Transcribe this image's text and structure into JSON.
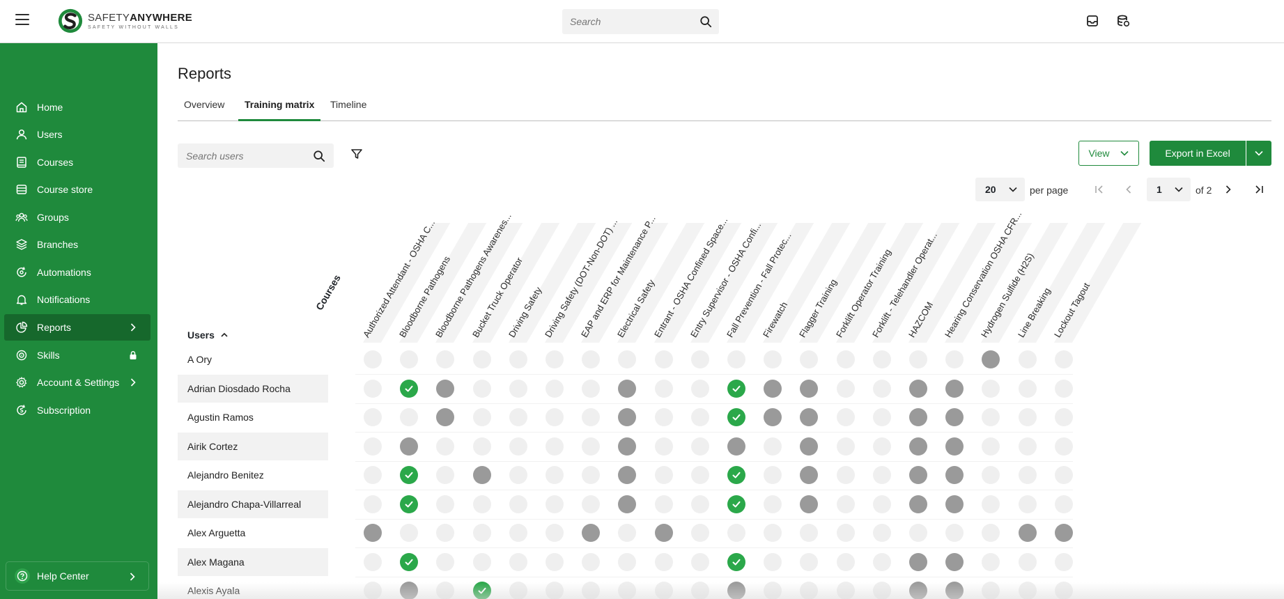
{
  "brand": {
    "name_light": "SAFETY",
    "name_bold": "ANYWHERE",
    "tagline": "SAFETY WITHOUT WALLS"
  },
  "topbar": {
    "search_placeholder": "Search"
  },
  "sidebar": {
    "items": [
      {
        "label": "Home",
        "icon": "home-icon"
      },
      {
        "label": "Users",
        "icon": "user-icon"
      },
      {
        "label": "Courses",
        "icon": "book-icon"
      },
      {
        "label": "Course store",
        "icon": "store-icon"
      },
      {
        "label": "Groups",
        "icon": "groups-icon"
      },
      {
        "label": "Branches",
        "icon": "layers-icon"
      },
      {
        "label": "Automations",
        "icon": "automation-icon"
      },
      {
        "label": "Notifications",
        "icon": "bell-icon"
      },
      {
        "label": "Reports",
        "icon": "pie-chart-icon"
      },
      {
        "label": "Skills",
        "icon": "skills-icon"
      },
      {
        "label": "Account & Settings",
        "icon": "gear-icon"
      },
      {
        "label": "Subscription",
        "icon": "subscription-icon"
      }
    ],
    "help_label": "Help Center"
  },
  "page": {
    "title": "Reports",
    "tabs": [
      "Overview",
      "Training matrix",
      "Timeline"
    ],
    "active_tab": "Training matrix"
  },
  "toolbar": {
    "search_placeholder": "Search users",
    "view_label": "View",
    "export_label": "Export in Excel"
  },
  "pagination": {
    "per_page_value": "20",
    "per_page_label": "per page",
    "page_value": "1",
    "of_label": "of 2"
  },
  "matrix": {
    "courses_label": "Courses",
    "users_label": "Users",
    "courses": [
      "Authorized Attendant - OSHA C...",
      "Bloodborne Pathogens",
      "Bloodborne Pathogens Awarenes...",
      "Bucket Truck Operator",
      "Driving Safety",
      "Driving Safety (DOT-Non-DOT) ...",
      "EAP and ERP for Maintenance P...",
      "Electrical Safety",
      "Entrant - OSHA Confined Space...",
      "Entry Supervisor - OSHA Confi...",
      "Fall Prevention - Fall Protec...",
      "Firewatch",
      "Flagger Training",
      "Forklift Operator Training",
      "Forklift - Telehandler Operat...",
      "HAZCOM",
      "Hearing Conservation OSHA CFR...",
      "Hydrogen Sulfide (H2S)",
      "Line Breaking",
      "Lockout Tagout"
    ],
    "rows": [
      {
        "name": "A Ory",
        "cells": [
          0,
          0,
          0,
          0,
          0,
          0,
          0,
          0,
          0,
          0,
          0,
          0,
          0,
          0,
          0,
          0,
          0,
          1,
          0,
          0
        ]
      },
      {
        "name": "Adrian Diosdado Rocha",
        "cells": [
          0,
          2,
          1,
          0,
          0,
          0,
          0,
          1,
          0,
          0,
          2,
          1,
          1,
          0,
          0,
          1,
          1,
          0,
          0,
          0
        ]
      },
      {
        "name": "Agustin Ramos",
        "cells": [
          0,
          0,
          1,
          0,
          0,
          0,
          0,
          1,
          0,
          0,
          2,
          1,
          1,
          0,
          0,
          1,
          1,
          0,
          0,
          0
        ]
      },
      {
        "name": "Airik Cortez",
        "cells": [
          0,
          1,
          0,
          0,
          0,
          0,
          0,
          1,
          0,
          0,
          1,
          0,
          1,
          0,
          0,
          1,
          1,
          0,
          0,
          0
        ]
      },
      {
        "name": "Alejandro Benitez",
        "cells": [
          0,
          2,
          0,
          1,
          0,
          0,
          0,
          1,
          0,
          0,
          2,
          0,
          1,
          0,
          0,
          1,
          1,
          0,
          0,
          0
        ]
      },
      {
        "name": "Alejandro Chapa-Villarreal",
        "cells": [
          0,
          2,
          0,
          0,
          0,
          0,
          0,
          1,
          0,
          0,
          2,
          0,
          1,
          0,
          0,
          1,
          1,
          0,
          0,
          0
        ]
      },
      {
        "name": "Alex Arguetta",
        "cells": [
          1,
          0,
          0,
          0,
          0,
          0,
          1,
          0,
          1,
          0,
          0,
          0,
          0,
          0,
          0,
          0,
          0,
          0,
          1,
          1
        ]
      },
      {
        "name": "Alex Magana",
        "cells": [
          0,
          2,
          0,
          0,
          0,
          0,
          0,
          0,
          0,
          0,
          2,
          0,
          0,
          0,
          0,
          1,
          1,
          0,
          0,
          0
        ]
      },
      {
        "name": "Alexis Ayala",
        "cells": [
          0,
          1,
          0,
          2,
          0,
          0,
          0,
          0,
          0,
          0,
          1,
          0,
          0,
          0,
          0,
          1,
          1,
          0,
          0,
          0
        ]
      }
    ]
  },
  "colors": {
    "brand_green": "#1f8a3c",
    "active_nav": "#16682c",
    "done": "#2ba84a",
    "assigned": "#9a9a9a",
    "empty": "#efefef"
  }
}
